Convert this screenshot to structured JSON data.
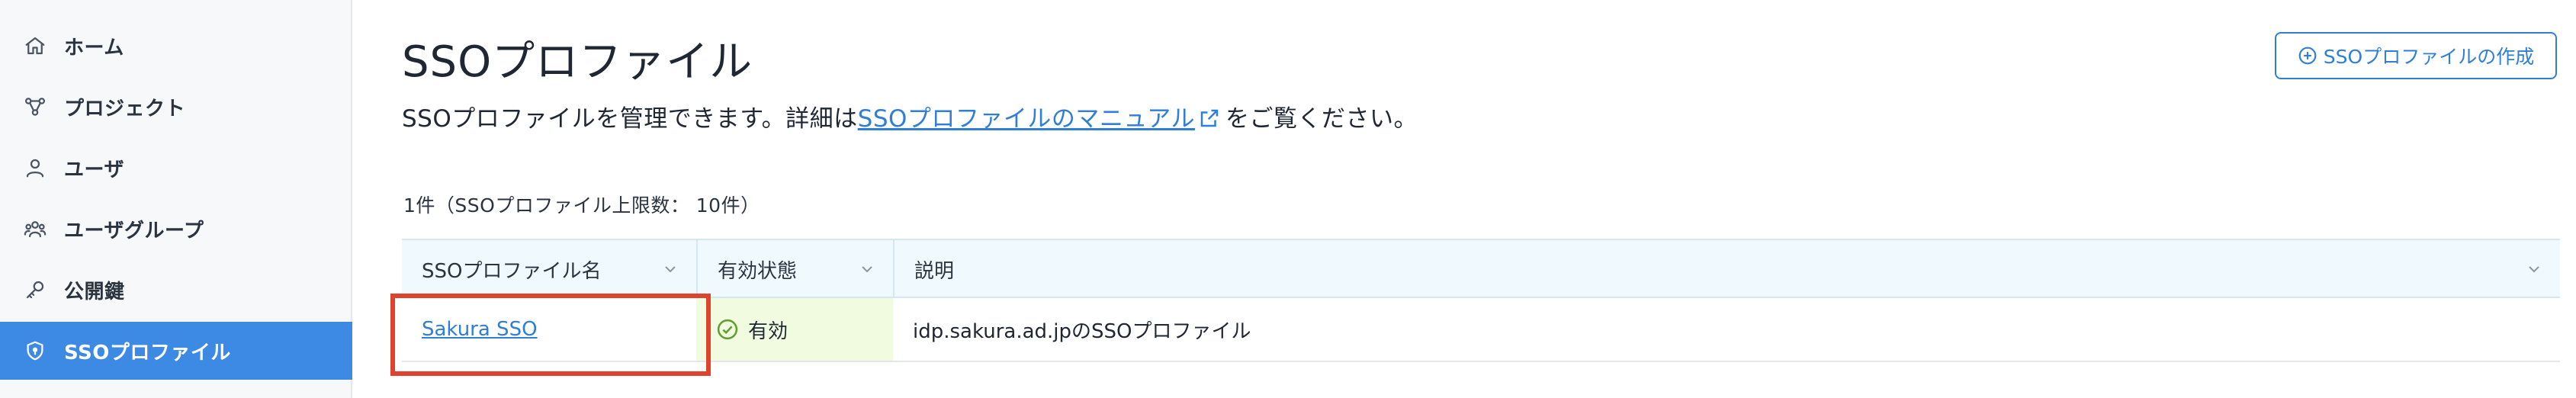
{
  "sidebar": {
    "items": [
      {
        "label": "ホーム",
        "icon": "home-icon"
      },
      {
        "label": "プロジェクト",
        "icon": "project-icon"
      },
      {
        "label": "ユーザ",
        "icon": "user-icon"
      },
      {
        "label": "ユーザグループ",
        "icon": "user-group-icon"
      },
      {
        "label": "公開鍵",
        "icon": "key-icon"
      },
      {
        "label": "SSOプロファイル",
        "icon": "shield-icon",
        "active": true
      }
    ]
  },
  "header": {
    "title": "SSOプロファイル",
    "create_button_label": "SSOプロファイルの作成",
    "description_prefix": "SSOプロファイルを管理できます。詳細は",
    "description_link": "SSOプロファイルのマニュアル",
    "description_suffix": "をご覧ください。"
  },
  "summary": {
    "count_text": "1件（SSOプロファイル上限数： 10件）"
  },
  "table": {
    "columns": [
      "SSOプロファイル名",
      "有効状態",
      "説明"
    ],
    "rows": [
      {
        "name": "Sakura SSO",
        "status": "有効",
        "description": "idp.sakura.ad.jpのSSOプロファイル"
      }
    ]
  },
  "colors": {
    "accent": "#3d8ae5",
    "link": "#2f7ed8",
    "status_ok": "#5da02d",
    "highlight": "#e0432d"
  }
}
